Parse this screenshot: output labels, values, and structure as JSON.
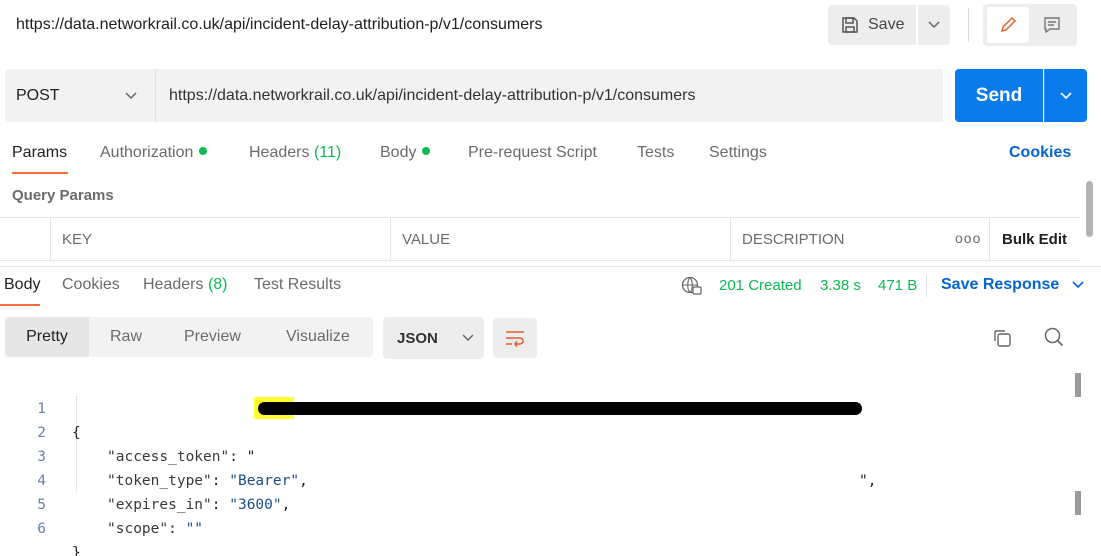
{
  "header": {
    "title": "https://data.networkrail.co.uk/api/incident-delay-attribution-p/v1/consumers",
    "save_label": "Save"
  },
  "request": {
    "method": "POST",
    "url": "https://data.networkrail.co.uk/api/incident-delay-attribution-p/v1/consumers",
    "send_label": "Send"
  },
  "request_tabs": {
    "params": "Params",
    "authorization": "Authorization",
    "headers": "Headers",
    "headers_count": "(11)",
    "body": "Body",
    "pre_request": "Pre-request Script",
    "tests": "Tests",
    "settings": "Settings",
    "cookies": "Cookies"
  },
  "query_params": {
    "title": "Query Params",
    "columns": [
      "KEY",
      "VALUE",
      "DESCRIPTION"
    ],
    "more": "ooo",
    "bulk_edit": "Bulk Edit"
  },
  "response_tabs": {
    "body": "Body",
    "cookies": "Cookies",
    "headers": "Headers",
    "headers_count": "(8)",
    "test_results": "Test Results"
  },
  "response_meta": {
    "status": "201 Created",
    "time": "3.38 s",
    "size": "471 B",
    "save_response": "Save Response"
  },
  "viewer": {
    "modes": [
      "Pretty",
      "Raw",
      "Preview",
      "Visualize"
    ],
    "format": "JSON"
  },
  "code": {
    "line_numbers": [
      "1",
      "2",
      "3",
      "4",
      "5",
      "6"
    ],
    "open_brace": "{",
    "close_brace": "}",
    "access_token_key": "\"access_token\"",
    "access_token_open": ": \"",
    "access_token_close": "\",",
    "token_type_key": "\"token_type\"",
    "token_type_value": "\"Bearer\"",
    "expires_in_key": "\"expires_in\"",
    "expires_in_value": "\"3600\"",
    "scope_key": "\"scope\"",
    "scope_value": "\"\""
  },
  "colors": {
    "accent": "#ff6c37",
    "primary": "#097bed",
    "success": "#0cbb52",
    "link": "#0265d2"
  }
}
